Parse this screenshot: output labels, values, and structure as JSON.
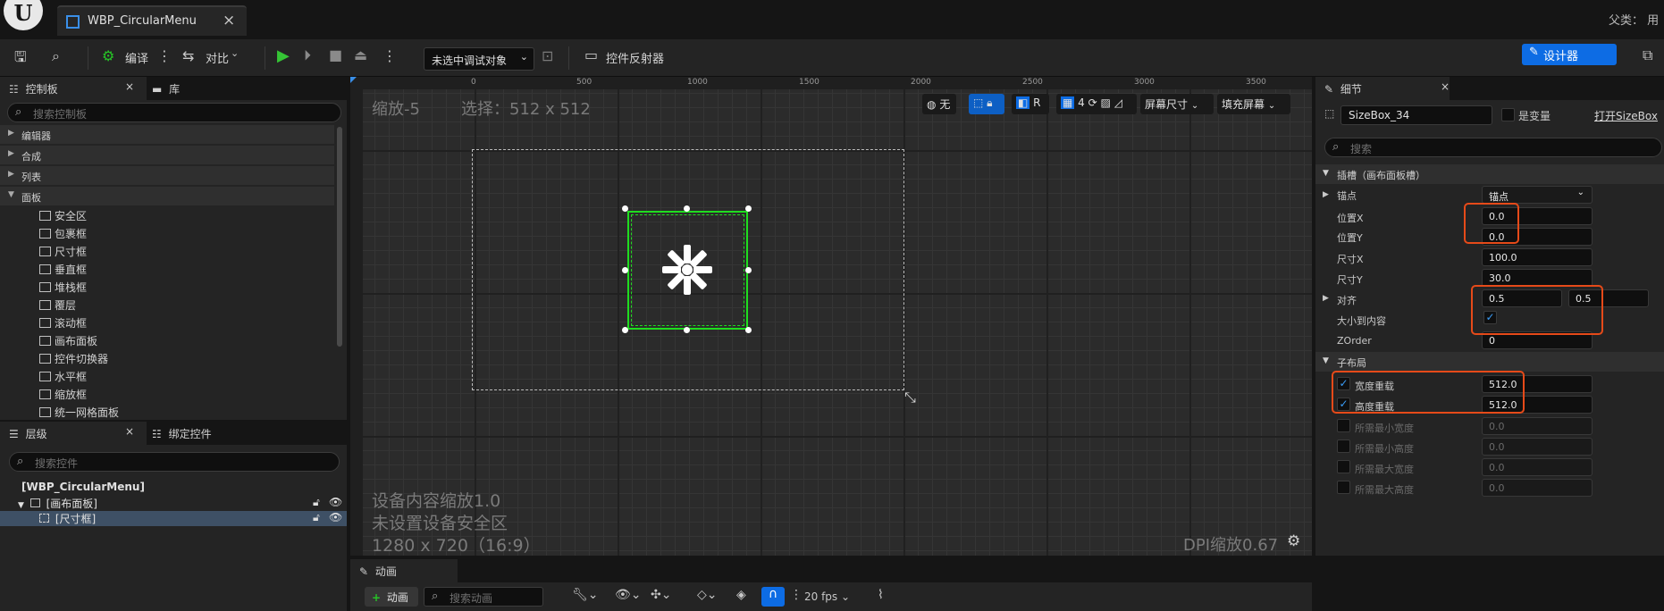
{
  "window": {
    "tab_title": "WBP_CircularMenu",
    "parent_label": "父类： 用"
  },
  "toolbar": {
    "compile_label": "编译",
    "diff_label": "对比",
    "debug_select_value": "未选中调试对象",
    "reflector_label": "控件反射器",
    "designer_label": "设计器"
  },
  "palette": {
    "tab_label": "控制板",
    "library_tab_label": "库",
    "search_placeholder": "搜索控制板",
    "categories": [
      "编辑器",
      "合成",
      "列表",
      "面板"
    ],
    "items": [
      "安全区",
      "包裹框",
      "尺寸框",
      "垂直框",
      "堆栈框",
      "覆层",
      "滚动框",
      "画布面板",
      "控件切换器",
      "水平框",
      "缩放框",
      "统一网格面板"
    ]
  },
  "hierarchy": {
    "tab_label": "层级",
    "bind_tab_label": "绑定控件",
    "search_placeholder": "搜索控件",
    "root": "[WBP_CircularMenu]",
    "canvas": "[画布面板]",
    "sizebox": "[尺寸框]"
  },
  "viewport": {
    "zoom_text": "缩放-5",
    "selection_text": "选择：512 x 512",
    "ruler_top": [
      "0",
      "500",
      "1000",
      "1500",
      "2000",
      "2500",
      "3000",
      "3500"
    ],
    "tool_none": "无",
    "tool_r": "R",
    "tool_grid_value": "4",
    "screen_size_label": "屏幕尺寸",
    "fill_screen_label": "填充屏幕",
    "device_scale": "设备内容缩放1.0",
    "safe_zone": "未设置设备安全区",
    "resolution": "1280 x 720（16:9）",
    "dpi": "DPI缩放0.67"
  },
  "details": {
    "tab_label": "细节",
    "name_value": "SizeBox_34",
    "is_variable_label": "是变量",
    "open_link": "打开SizeBox",
    "search_placeholder": "搜索",
    "slot_section": "插槽（画布面板槽）",
    "anchor_label": "锚点",
    "anchor_value": "锚点",
    "pos_x_label": "位置X",
    "pos_x_value": "0.0",
    "pos_y_label": "位置Y",
    "pos_y_value": "0.0",
    "size_x_label": "尺寸X",
    "size_x_value": "100.0",
    "size_y_label": "尺寸Y",
    "size_y_value": "30.0",
    "align_label": "对齐",
    "align_x": "0.5",
    "align_y": "0.5",
    "size_to_content_label": "大小到内容",
    "zorder_label": "ZOrder",
    "zorder_value": "0",
    "child_layout_section": "子布局",
    "width_override_label": "宽度重载",
    "width_override_value": "512.0",
    "height_override_label": "高度重载",
    "height_override_value": "512.0",
    "min_width_label": "所需最小宽度",
    "min_width_value": "0.0",
    "min_height_label": "所需最小高度",
    "min_height_value": "0.0",
    "max_width_label": "所需最大宽度",
    "max_width_value": "0.0",
    "max_height_label": "所需最大高度",
    "max_height_value": "0.0"
  },
  "animation": {
    "tab_label": "动画",
    "add_label": "动画",
    "search_placeholder": "搜索动画",
    "fps_label": "20 fps"
  },
  "colors": {
    "accent": "#0d6ce4",
    "selection_green": "#1fdd1f",
    "highlight_orange": "#e64a19"
  }
}
